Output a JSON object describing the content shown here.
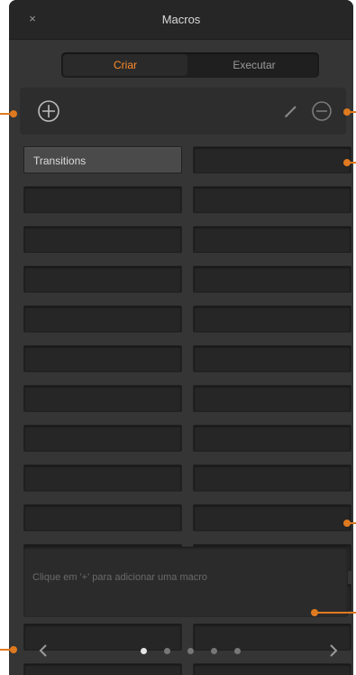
{
  "window": {
    "title": "Macros",
    "close_symbol": "×"
  },
  "tabs": [
    {
      "label": "Criar",
      "selected": true
    },
    {
      "label": "Executar",
      "selected": false
    }
  ],
  "macro_slots": [
    {
      "label": "Transitions",
      "filled": true
    },
    {
      "label": "",
      "filled": false
    },
    {
      "label": "",
      "filled": false
    },
    {
      "label": "",
      "filled": false
    },
    {
      "label": "",
      "filled": false
    },
    {
      "label": "",
      "filled": false
    },
    {
      "label": "",
      "filled": false
    },
    {
      "label": "",
      "filled": false
    },
    {
      "label": "",
      "filled": false
    },
    {
      "label": "",
      "filled": false
    },
    {
      "label": "",
      "filled": false
    },
    {
      "label": "",
      "filled": false
    },
    {
      "label": "",
      "filled": false
    },
    {
      "label": "",
      "filled": false
    },
    {
      "label": "",
      "filled": false
    },
    {
      "label": "",
      "filled": false
    },
    {
      "label": "",
      "filled": false
    },
    {
      "label": "",
      "filled": false
    },
    {
      "label": "",
      "filled": false
    },
    {
      "label": "",
      "filled": false
    },
    {
      "label": "",
      "filled": false
    },
    {
      "label": "",
      "filled": false
    },
    {
      "label": "",
      "filled": false
    },
    {
      "label": "",
      "filled": false
    },
    {
      "label": "",
      "filled": false
    },
    {
      "label": "",
      "filled": false
    },
    {
      "label": "",
      "filled": false
    },
    {
      "label": "",
      "filled": false
    }
  ],
  "description": {
    "placeholder": "Clique em '+' para adicionar uma macro"
  },
  "pagination": {
    "pages": 5,
    "current": 1
  },
  "icons": {
    "add": "add-macro-icon",
    "edit": "edit-macro-icon",
    "remove": "remove-macro-icon",
    "prev": "chevron-left-icon",
    "next": "chevron-right-icon"
  },
  "colors": {
    "panel": "#353535",
    "titlebar": "#262626",
    "accent": "#ff8c2a",
    "callout": "#e07a1f"
  }
}
